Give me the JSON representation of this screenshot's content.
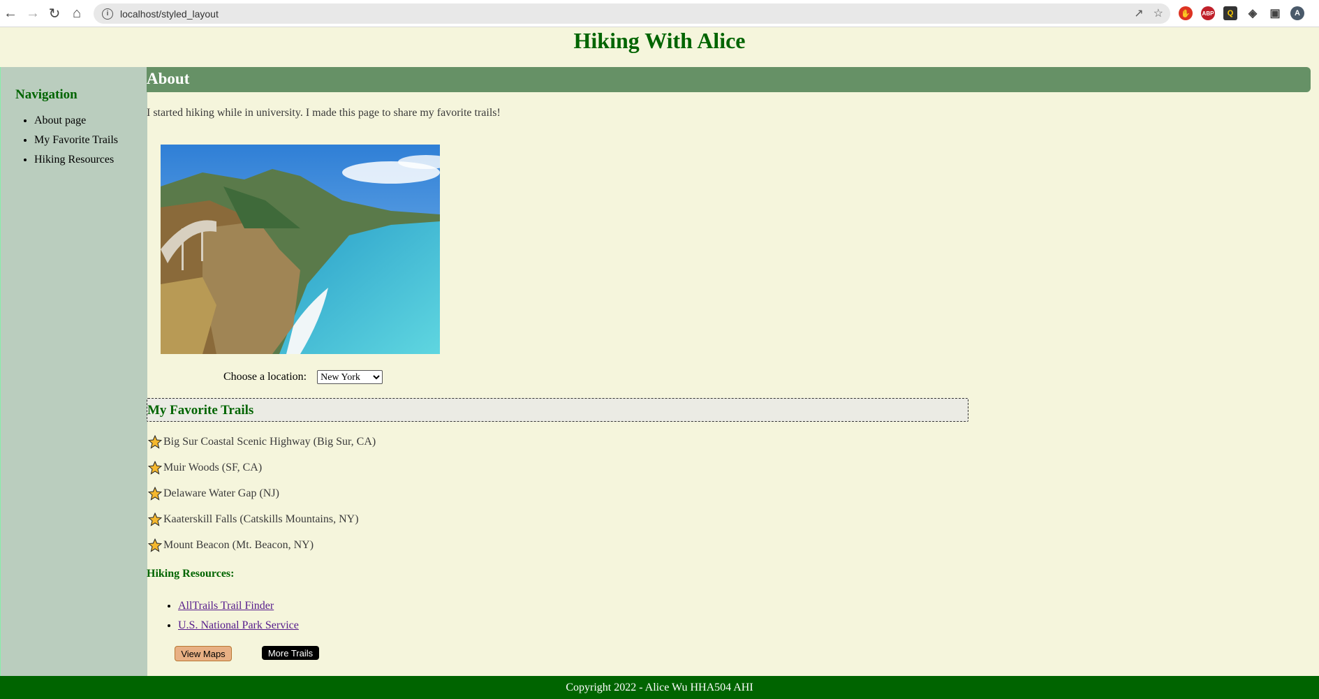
{
  "browser": {
    "url": "localhost/styled_layout",
    "profile_initial": "A",
    "ext_abp": "ABP"
  },
  "site": {
    "title": "Hiking With Alice"
  },
  "sidebar": {
    "heading": "Navigation",
    "items": [
      {
        "label": "About page"
      },
      {
        "label": "My Favorite Trails"
      },
      {
        "label": "Hiking Resources"
      }
    ]
  },
  "about": {
    "heading": "About",
    "intro": "I started hiking while in university. I made this page to share my favorite trails!"
  },
  "location": {
    "label": "Choose a location:",
    "selected": "New York"
  },
  "favorites": {
    "heading": "My Favorite Trails",
    "trails": [
      {
        "name": "Big Sur Coastal Scenic Highway (Big Sur, CA)"
      },
      {
        "name": "Muir Woods (SF, CA)"
      },
      {
        "name": "Delaware Water Gap (NJ)"
      },
      {
        "name": "Kaaterskill Falls (Catskills Mountains, NY)"
      },
      {
        "name": "Mount Beacon (Mt. Beacon, NY)"
      }
    ]
  },
  "resources": {
    "heading": "Hiking Resources:",
    "links": [
      {
        "label": "AllTrails Trail Finder"
      },
      {
        "label": "U.S. National Park Service"
      }
    ]
  },
  "buttons": {
    "view_maps": "View Maps",
    "more_trails": "More Trails"
  },
  "footer": {
    "text": "Copyright 2022 - Alice Wu HHA504 AHI"
  },
  "colors": {
    "page_bg": "#f5f5dc",
    "brand_green": "#006400",
    "about_bar": "#669166",
    "sidebar_bg": "#bacdbe"
  }
}
